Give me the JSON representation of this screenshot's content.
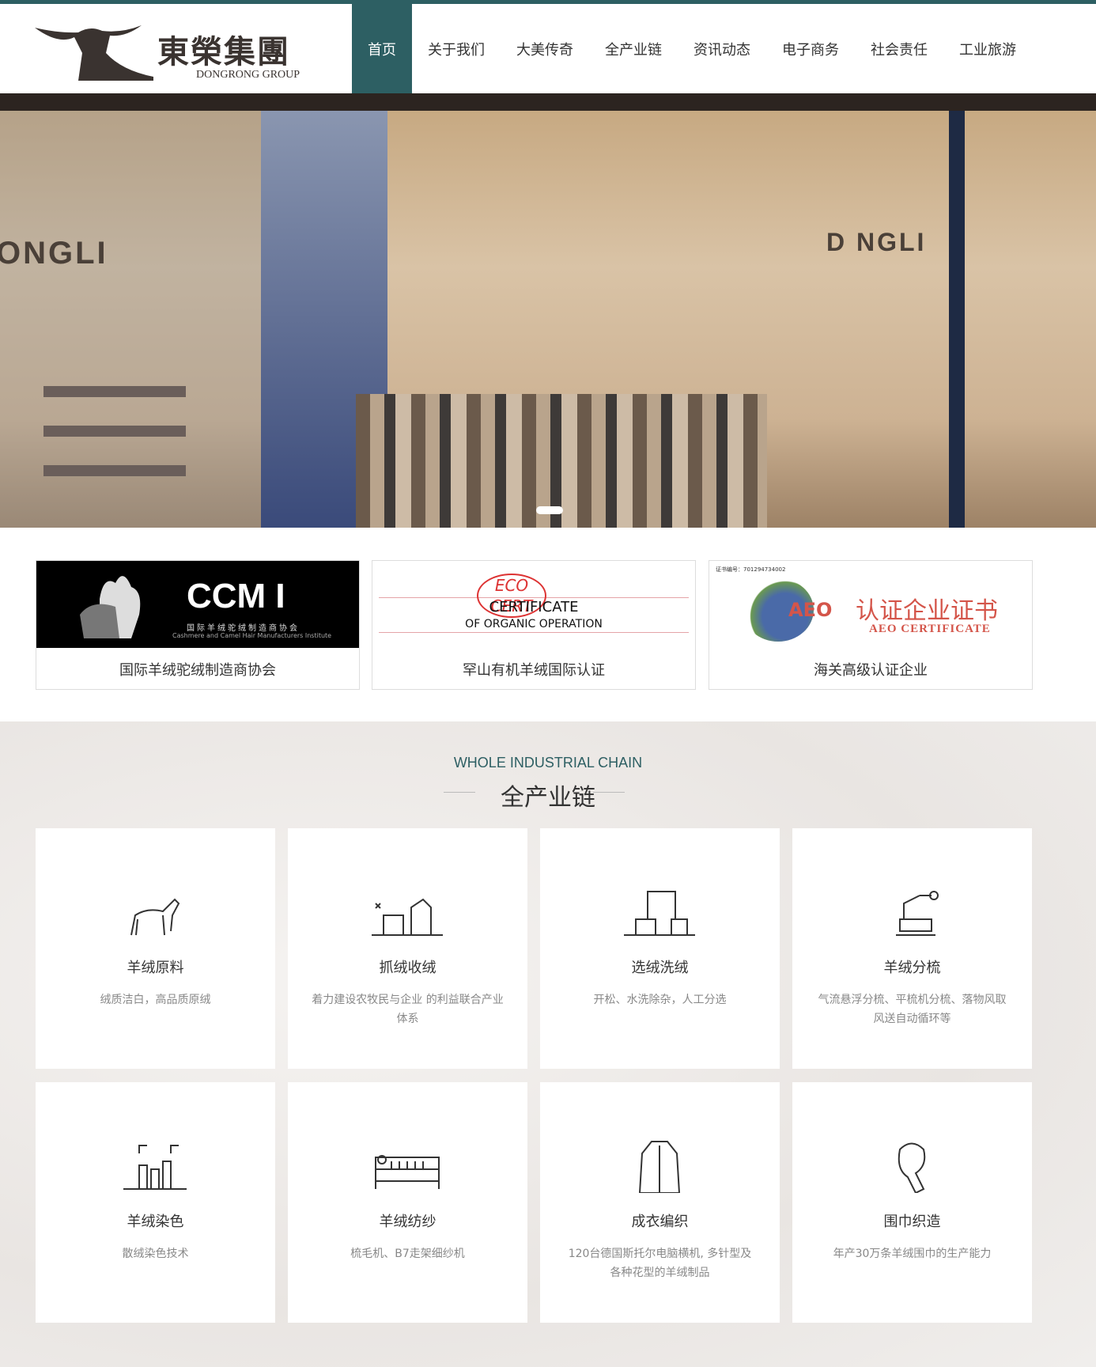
{
  "header": {
    "logo_cn": "東榮集團",
    "logo_en": "DONGRONG GROUP",
    "nav": [
      "首页",
      "关于我们",
      "大美传奇",
      "全产业链",
      "资讯动态",
      "电子商务",
      "社会责任",
      "工业旅游"
    ],
    "active": "首页"
  },
  "banner": {
    "wall_left": "ONGLI",
    "wall_right": "D NGLI",
    "slides": 1
  },
  "certs": [
    {
      "caption": "国际羊绒驼绒制造商协会",
      "logo_title": "CCM I",
      "logo_cn": "国际羊绒驼绒制造商协会",
      "logo_en": "Cashmere and Camel Hair Manufacturers Institute"
    },
    {
      "caption": "罕山有机羊绒国际认证",
      "logo_top": "ECO CERT",
      "logo_title": "CERTIFICATE",
      "logo_sub": "OF ORGANIC OPERATION"
    },
    {
      "caption": "海关高级认证企业",
      "logo_no": "证书编号：701294734002",
      "logo_badge": "AEO",
      "logo_title": "认证企业证书",
      "logo_sub": "AEO CERTIFICATE"
    }
  ],
  "section": {
    "title_en": "WHOLE INDUSTRIAL CHAIN",
    "title_cn": "全产业链",
    "items": [
      {
        "title": "羊绒原料",
        "desc": "绒质洁白，高品质原绒",
        "icon": "goat-icon"
      },
      {
        "title": "抓绒收绒",
        "desc": "着力建设农牧民与企业 的利益联合产业体系",
        "icon": "factory-icon"
      },
      {
        "title": "选绒洗绒",
        "desc": "开松、水洗除杂，人工分选",
        "icon": "washing-machine-icon"
      },
      {
        "title": "羊绒分梳",
        "desc": "气流悬浮分梳、平梳机分梳、落物风取风送自动循环等",
        "icon": "robot-arm-icon"
      },
      {
        "title": "羊绒染色",
        "desc": "散绒染色技术",
        "icon": "dyeing-icon"
      },
      {
        "title": "羊绒纺纱",
        "desc": "梳毛机、B7走架细纱机",
        "icon": "spinning-machine-icon"
      },
      {
        "title": "成衣编织",
        "desc": "120台德国斯托尔电脑横机, 多针型及各种花型的羊绒制品",
        "icon": "coat-icon"
      },
      {
        "title": "围巾织造",
        "desc": "年产30万条羊绒围巾的生产能力",
        "icon": "scarf-icon"
      }
    ]
  },
  "colors": {
    "brand": "#2d5f63"
  }
}
